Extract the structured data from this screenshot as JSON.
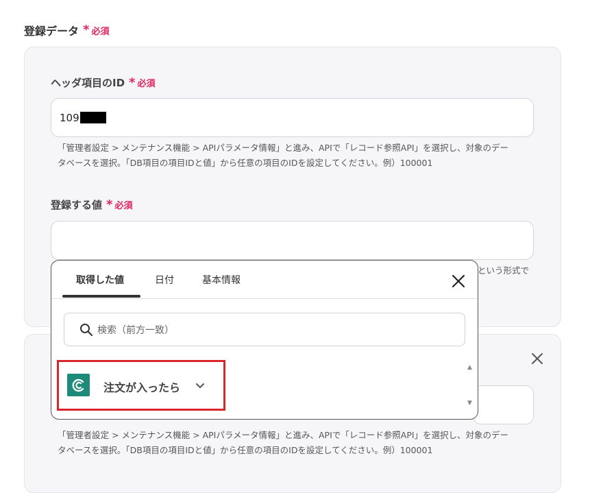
{
  "section": {
    "title": "登録データ",
    "required_star": "*",
    "required_text": "必須"
  },
  "field1": {
    "label": "ヘッダ項目のID",
    "required_star": "*",
    "required_text": "必須",
    "value": "109",
    "help_line1": "「管理者設定 > メンテナンス機能 > APIパラメータ情報」と進み、APIで「レコード参照API」を選択し、対象のデー",
    "help_line2": "タベースを選択。「DB項目の項目IDと値」から任意の項目のIDを設定してください。例）100001"
  },
  "field2": {
    "label": "登録する値",
    "required_star": "*",
    "required_text": "必須",
    "value": "",
    "help_partial": "という形式で"
  },
  "card2": {
    "help_line1": "「管理者設定 > メンテナンス機能 > APIパラメータ情報」と進み、APIで「レコード参照API」を選択し、対象のデー",
    "help_line2": "タベースを選択。「DB項目の項目IDと値」から任意の項目のIDを設定してください。例）100001"
  },
  "popup": {
    "tabs": [
      "取得した値",
      "日付",
      "基本情報"
    ],
    "active_tab": "取得した値",
    "search_placeholder": "検索（前方一致）",
    "item_label": "注文が入ったら",
    "app_color": "#1d8a7a",
    "highlight_color": "#d9262b"
  }
}
